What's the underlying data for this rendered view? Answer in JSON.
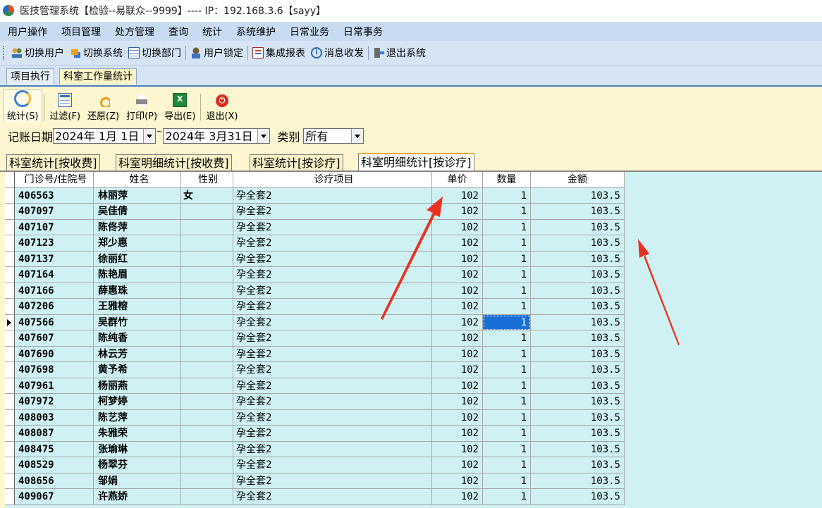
{
  "window": {
    "title": "医技管理系统【检验--易联众--9999】---- IP：192.168.3.6【sayy】"
  },
  "menu": [
    "用户操作",
    "项目管理",
    "处方管理",
    "查询",
    "统计",
    "系统维护",
    "日常业务",
    "日常事务"
  ],
  "toolbar": [
    {
      "label": "切换用户",
      "icon": "users-icon"
    },
    {
      "label": "切换系统",
      "icon": "switch-system-icon"
    },
    {
      "label": "切换部门",
      "icon": "department-icon"
    },
    {
      "label": "用户锁定",
      "icon": "user-lock-icon"
    },
    {
      "label": "集成报表",
      "icon": "report-icon"
    },
    {
      "label": "消息收发",
      "icon": "message-icon"
    },
    {
      "label": "退出系统",
      "icon": "exit-system-icon"
    }
  ],
  "workspace_tabs": [
    "项目执行",
    "科室工作量统计"
  ],
  "actions": [
    {
      "label": "统计(S)",
      "icon": "statistics-icon"
    },
    {
      "label": "过滤(F)",
      "icon": "filter-icon"
    },
    {
      "label": "还原(Z)",
      "icon": "undo-icon"
    },
    {
      "label": "打印(P)",
      "icon": "print-icon"
    },
    {
      "label": "导出(E)",
      "icon": "excel-export-icon"
    },
    {
      "label": "退出(X)",
      "icon": "exit-icon"
    }
  ],
  "filter": {
    "date_label": "记账日期",
    "date_from": "2024年 1月 1日",
    "range_sep": "~",
    "date_to": "2024年 3月31日",
    "category_label": "类别",
    "category_value": "所有"
  },
  "sub_tabs": [
    "科室统计[按收费]",
    "科室明细统计[按收费]",
    "科室统计[按诊疗]",
    "科室明细统计[按诊疗]"
  ],
  "active_sub_tab": 3,
  "table": {
    "columns": [
      "门诊号/住院号",
      "姓名",
      "性别",
      "诊疗项目",
      "单价",
      "数量",
      "金额"
    ],
    "selected_row": 8,
    "rows": [
      [
        "406563",
        "林丽萍",
        "女",
        "孕全套2",
        "102",
        "1",
        "103.5"
      ],
      [
        "407097",
        "吴佳倩",
        "",
        "孕全套2",
        "102",
        "1",
        "103.5"
      ],
      [
        "407107",
        "陈佟萍",
        "",
        "孕全套2",
        "102",
        "1",
        "103.5"
      ],
      [
        "407123",
        "郑少惠",
        "",
        "孕全套2",
        "102",
        "1",
        "103.5"
      ],
      [
        "407137",
        "徐丽红",
        "",
        "孕全套2",
        "102",
        "1",
        "103.5"
      ],
      [
        "407164",
        "陈艳眉",
        "",
        "孕全套2",
        "102",
        "1",
        "103.5"
      ],
      [
        "407166",
        "薛惠珠",
        "",
        "孕全套2",
        "102",
        "1",
        "103.5"
      ],
      [
        "407206",
        "王雅榕",
        "",
        "孕全套2",
        "102",
        "1",
        "103.5"
      ],
      [
        "407566",
        "吴群竹",
        "",
        "孕全套2",
        "102",
        "1",
        "103.5"
      ],
      [
        "407607",
        "陈纯香",
        "",
        "孕全套2",
        "102",
        "1",
        "103.5"
      ],
      [
        "407690",
        "林云芳",
        "",
        "孕全套2",
        "102",
        "1",
        "103.5"
      ],
      [
        "407698",
        "黄予希",
        "",
        "孕全套2",
        "102",
        "1",
        "103.5"
      ],
      [
        "407961",
        "杨丽燕",
        "",
        "孕全套2",
        "102",
        "1",
        "103.5"
      ],
      [
        "407972",
        "柯梦婷",
        "",
        "孕全套2",
        "102",
        "1",
        "103.5"
      ],
      [
        "408003",
        "陈艺萍",
        "",
        "孕全套2",
        "102",
        "1",
        "103.5"
      ],
      [
        "408087",
        "朱雅荣",
        "",
        "孕全套2",
        "102",
        "1",
        "103.5"
      ],
      [
        "408475",
        "张瑜琳",
        "",
        "孕全套2",
        "102",
        "1",
        "103.5"
      ],
      [
        "408529",
        "杨翠芬",
        "",
        "孕全套2",
        "102",
        "1",
        "103.5"
      ],
      [
        "408656",
        "邹娟",
        "",
        "孕全套2",
        "102",
        "1",
        "103.5"
      ],
      [
        "409067",
        "许燕娇",
        "",
        "孕全套2",
        "102",
        "1",
        "103.5"
      ]
    ]
  },
  "colors": {
    "accent": "#1a6ed8",
    "grid_bg": "#d0f1f3",
    "annotation_arrow": "#e8321f"
  }
}
